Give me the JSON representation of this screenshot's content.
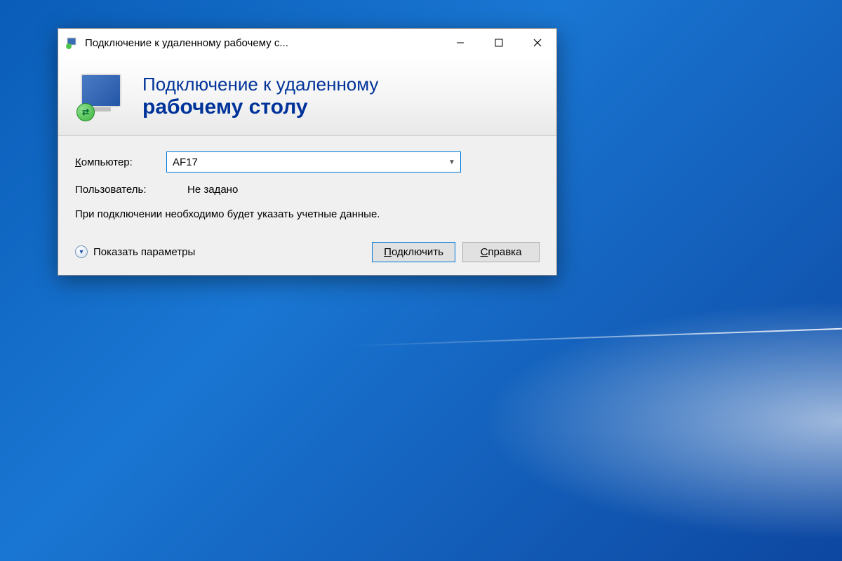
{
  "window": {
    "title": "Подключение к удаленному рабочему с..."
  },
  "banner": {
    "line1": "Подключение к удаленному",
    "line2": "рабочему столу"
  },
  "fields": {
    "computer_label_prefix": "К",
    "computer_label_rest": "омпьютер:",
    "computer_value": "AF17",
    "user_label": "Пользователь:",
    "user_value": "Не задано"
  },
  "hint": "При подключении необходимо будет указать учетные данные.",
  "buttons": {
    "show_options_prefix": "П",
    "show_options_rest": "оказать параметры",
    "connect_prefix": "П",
    "connect_rest": "одключить",
    "help_prefix": "С",
    "help_rest": "правка"
  }
}
